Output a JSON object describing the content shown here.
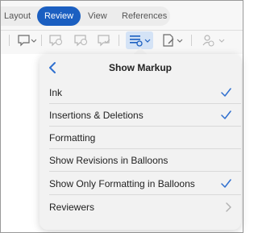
{
  "tabs": [
    "Layout",
    "Review",
    "View",
    "References"
  ],
  "active_tab": "Review",
  "popover": {
    "title": "Show Markup",
    "items": [
      {
        "label": "Ink",
        "checked": true
      },
      {
        "label": "Insertions & Deletions",
        "checked": true
      },
      {
        "label": "Formatting",
        "checked": false
      },
      {
        "label": "Show Revisions in Balloons",
        "checked": false
      },
      {
        "label": "Show Only Formatting in Balloons",
        "checked": true
      },
      {
        "label": "Reviewers",
        "submenu": true
      }
    ]
  },
  "colors": {
    "accent": "#1b5fc1",
    "check": "#2f6fcf",
    "selected_tool_bg": "#d4e3f6"
  },
  "icons": [
    "comment-icon",
    "prev-comment-icon",
    "next-comment-icon",
    "resolve-comment-icon",
    "show-markup-icon",
    "track-changes-icon",
    "reviewer-icon"
  ]
}
